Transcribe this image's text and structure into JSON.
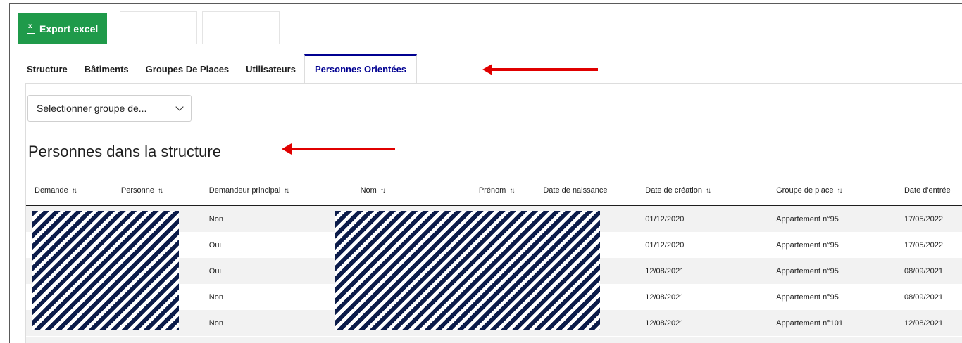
{
  "toolbar": {
    "export_label": "Export excel"
  },
  "tabs": [
    {
      "label": "Structure"
    },
    {
      "label": "Bâtiments"
    },
    {
      "label": "Groupes De Places"
    },
    {
      "label": "Utilisateurs"
    },
    {
      "label": "Personnes Orientées",
      "active": true
    }
  ],
  "group_select": {
    "value": "Selectionner groupe de..."
  },
  "section": {
    "title": "Personnes dans la structure"
  },
  "table": {
    "columns": [
      "Demande",
      "Personne",
      "Demandeur principal",
      "Nom",
      "Prénom",
      "Date de naissance",
      "Date de création",
      "Groupe de place",
      "Date d'entrée"
    ],
    "sortable": [
      true,
      true,
      true,
      true,
      true,
      false,
      true,
      true,
      false
    ],
    "rows": [
      {
        "principal": "Non",
        "creation": "01/12/2020",
        "groupe": "Appartement n°95",
        "entree": "17/05/2022"
      },
      {
        "principal": "Oui",
        "creation": "01/12/2020",
        "groupe": "Appartement n°95",
        "entree": "17/05/2022"
      },
      {
        "principal": "Oui",
        "creation": "12/08/2021",
        "groupe": "Appartement n°95",
        "entree": "08/09/2021"
      },
      {
        "principal": "Non",
        "creation": "12/08/2021",
        "groupe": "Appartement n°95",
        "entree": "08/09/2021"
      },
      {
        "principal": "Non",
        "creation": "12/08/2021",
        "groupe": "Appartement n°101",
        "entree": "12/08/2021"
      }
    ]
  },
  "colors": {
    "export_green": "#1f9a4a",
    "active_tab": "#000091",
    "annotation_arrow": "#e00000",
    "redaction": "#0c1c4a"
  }
}
